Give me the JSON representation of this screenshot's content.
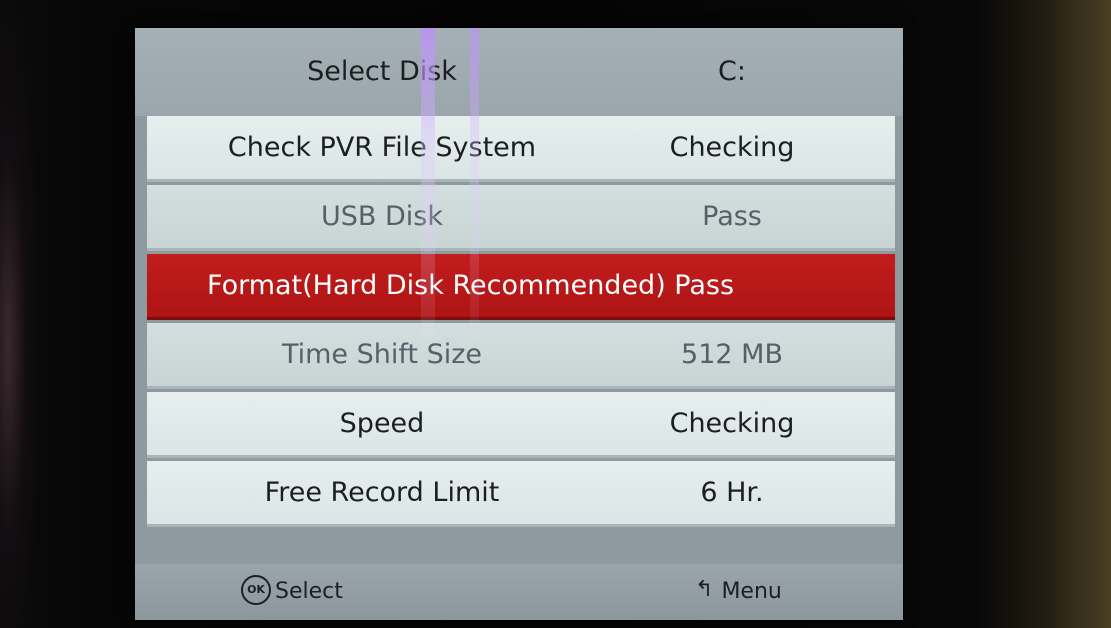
{
  "menu": {
    "header": {
      "label": "Select Disk",
      "value": "C:"
    },
    "rows": [
      {
        "label": "Check PVR File System",
        "value": "Checking"
      },
      {
        "label": "USB Disk",
        "value": "Pass"
      },
      {
        "label": "Format(Hard Disk Recommended) Pass",
        "value": ""
      },
      {
        "label": "Time Shift Size",
        "value": "512 MB"
      },
      {
        "label": "Speed",
        "value": "Checking"
      },
      {
        "label": "Free Record Limit",
        "value": "6 Hr."
      }
    ],
    "selected_row_index": 2
  },
  "footer": {
    "ok_icon_text": "OK",
    "select_label": "Select",
    "menu_label": "Menu",
    "ok_icon": "ok-button-icon",
    "back_icon": "back-arrow-icon"
  },
  "colors": {
    "selected_row": "#b81818",
    "row_background": "#e2eaea",
    "panel_background": "#8e9aa0"
  }
}
